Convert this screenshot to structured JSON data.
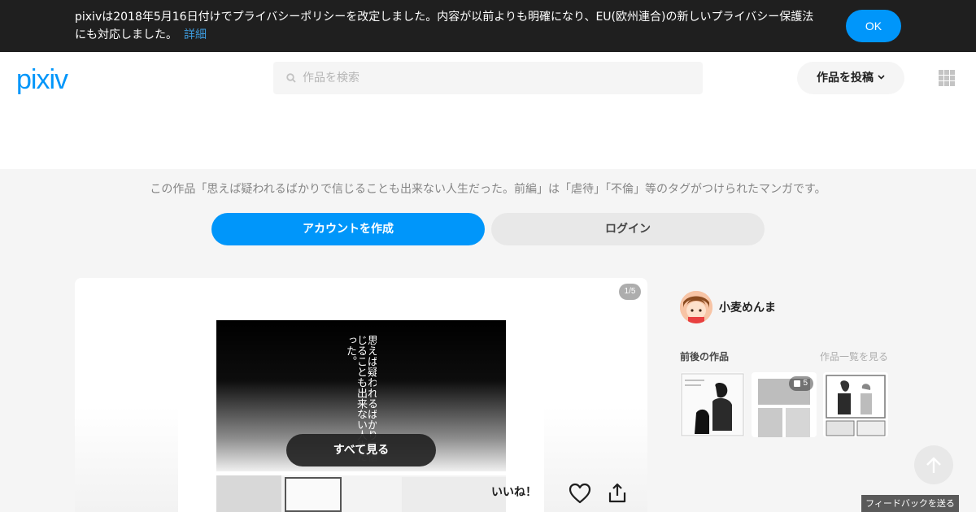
{
  "banner": {
    "text": "pixivは2018年5月16日付けでプライバシーポリシーを改定しました。内容が以前よりも明確になり、EU(欧州連合)の新しいプライバシー保護法にも対応しました。",
    "link_label": "詳細",
    "ok_label": "OK"
  },
  "header": {
    "logo": "pixiv",
    "search_placeholder": "作品を検索",
    "post_label": "作品を投稿"
  },
  "signup": {
    "description": "この作品「思えば疑われるばかりで信じることも出来ない人生だった。前編」は「虐待」「不倫」等のタグがつけられたマンガです。",
    "create_account_label": "アカウントを作成",
    "login_label": "ログイン"
  },
  "artwork": {
    "page_counter": "1/5",
    "manga_caption": "思えば疑われるばかりで信じることも出来ない人生だった。",
    "see_all_label": "すべて見る",
    "like_label": "いいね！"
  },
  "sidebar": {
    "author_name": "小麦めんま",
    "adjacent_title": "前後の作品",
    "see_list_label": "作品一覧を見る",
    "thumbnails": [
      {
        "badge": ""
      },
      {
        "badge": "5"
      },
      {
        "badge": ""
      }
    ]
  },
  "footer": {
    "feedback_label": "フィードバックを送る"
  },
  "colors": {
    "accent": "#0096fa",
    "banner_bg": "#1f1f1f",
    "page_bg": "#f5f5f5"
  }
}
